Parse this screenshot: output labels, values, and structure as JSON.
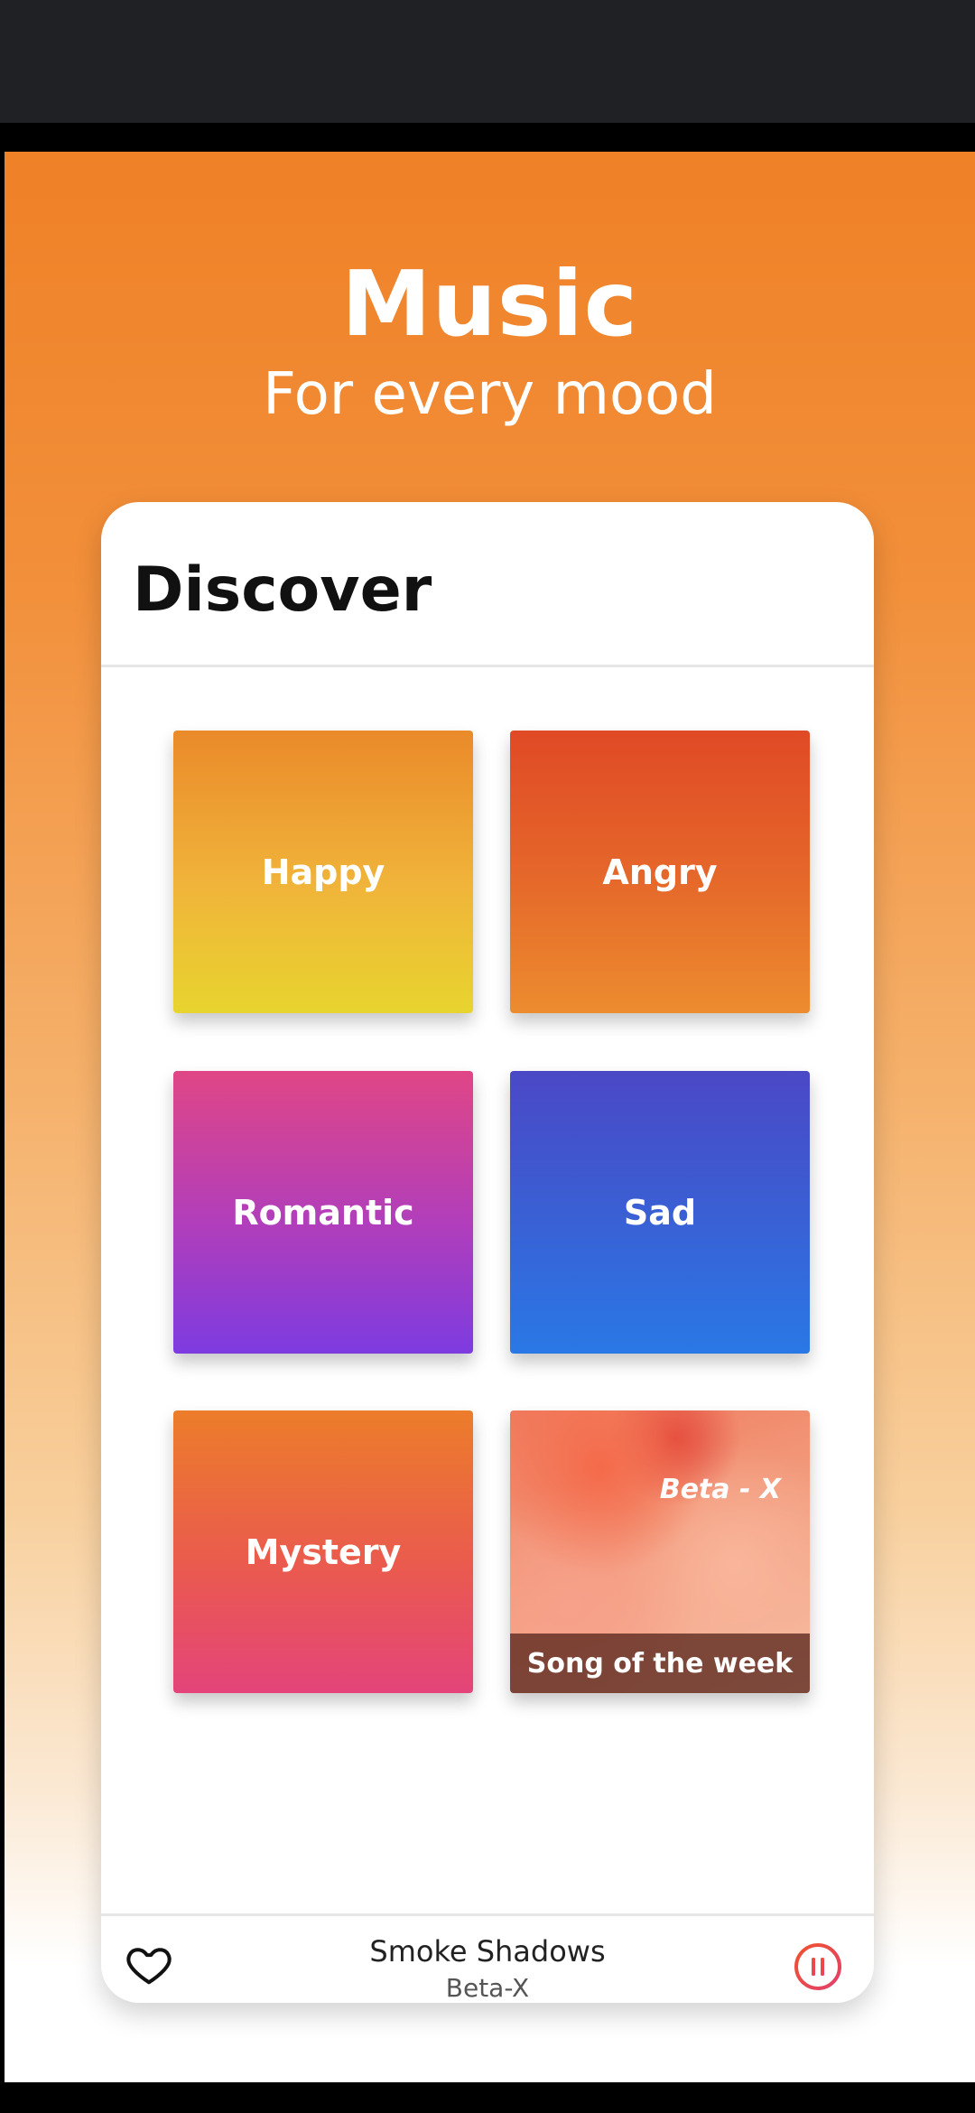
{
  "hero": {
    "title": "Music",
    "subtitle": "For every mood"
  },
  "discover": {
    "title": "Discover",
    "tiles": [
      {
        "label": "Happy"
      },
      {
        "label": "Angry"
      },
      {
        "label": "Romantic"
      },
      {
        "label": "Sad"
      },
      {
        "label": "Mystery"
      }
    ],
    "song_of_week": {
      "artist": "Beta - X",
      "caption": "Song of the week"
    }
  },
  "player": {
    "title": "Smoke Shadows",
    "artist": "Beta-X",
    "accent": "#f0532e"
  },
  "nav": {
    "items": [
      {
        "icon": "home-icon",
        "active": true
      },
      {
        "icon": "list-icon",
        "active": false
      },
      {
        "icon": "calendar-icon",
        "active": false
      },
      {
        "icon": "headphones-icon",
        "active": false
      }
    ]
  }
}
